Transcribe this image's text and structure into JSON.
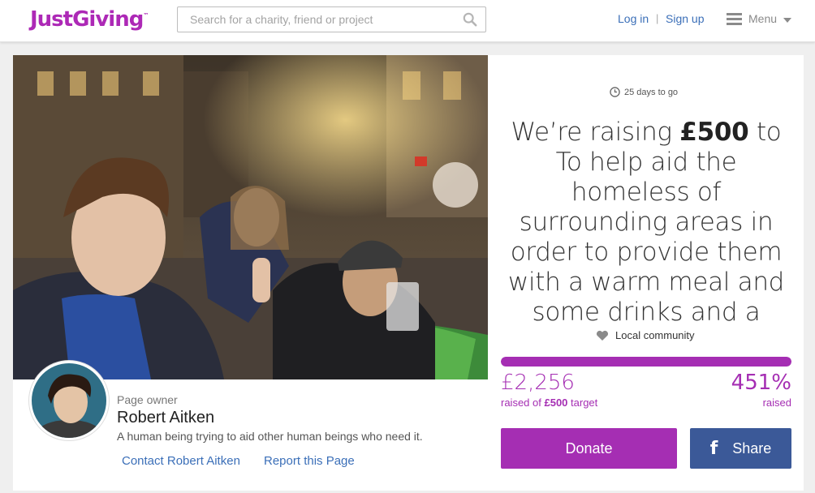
{
  "header": {
    "logo_text": "JustGiving",
    "logo_tm": "™",
    "search_placeholder": "Search for a charity, friend or project",
    "login_label": "Log in",
    "separator": "|",
    "signup_label": "Sign up",
    "menu_label": "Menu",
    "brand_color": "#ad29b6"
  },
  "campaign": {
    "days_to_go": "25 days to go",
    "headline_pre": "We’re raising ",
    "headline_amount": "£500",
    "headline_post": " to To help aid the homeless of surrounding areas in order to provide them with a warm meal and some drinks and a",
    "category": "Local community",
    "progress_percent": 100,
    "raised_amount": "£2,256",
    "raised_of": "raised of ",
    "target_amount": "£500",
    "target_word": " target",
    "percent_label": "451%",
    "percent_sub": "raised",
    "donate_label": "Donate",
    "share_label": "Share",
    "share_icon": "facebook-icon",
    "accent_color": "#a52eb3",
    "facebook_color": "#3b5998"
  },
  "owner": {
    "label": "Page owner",
    "name": "Robert Aitken",
    "bio": "A human being trying to aid other human beings who need it.",
    "contact_link": "Contact Robert Aitken",
    "report_link": "Report this Page"
  }
}
